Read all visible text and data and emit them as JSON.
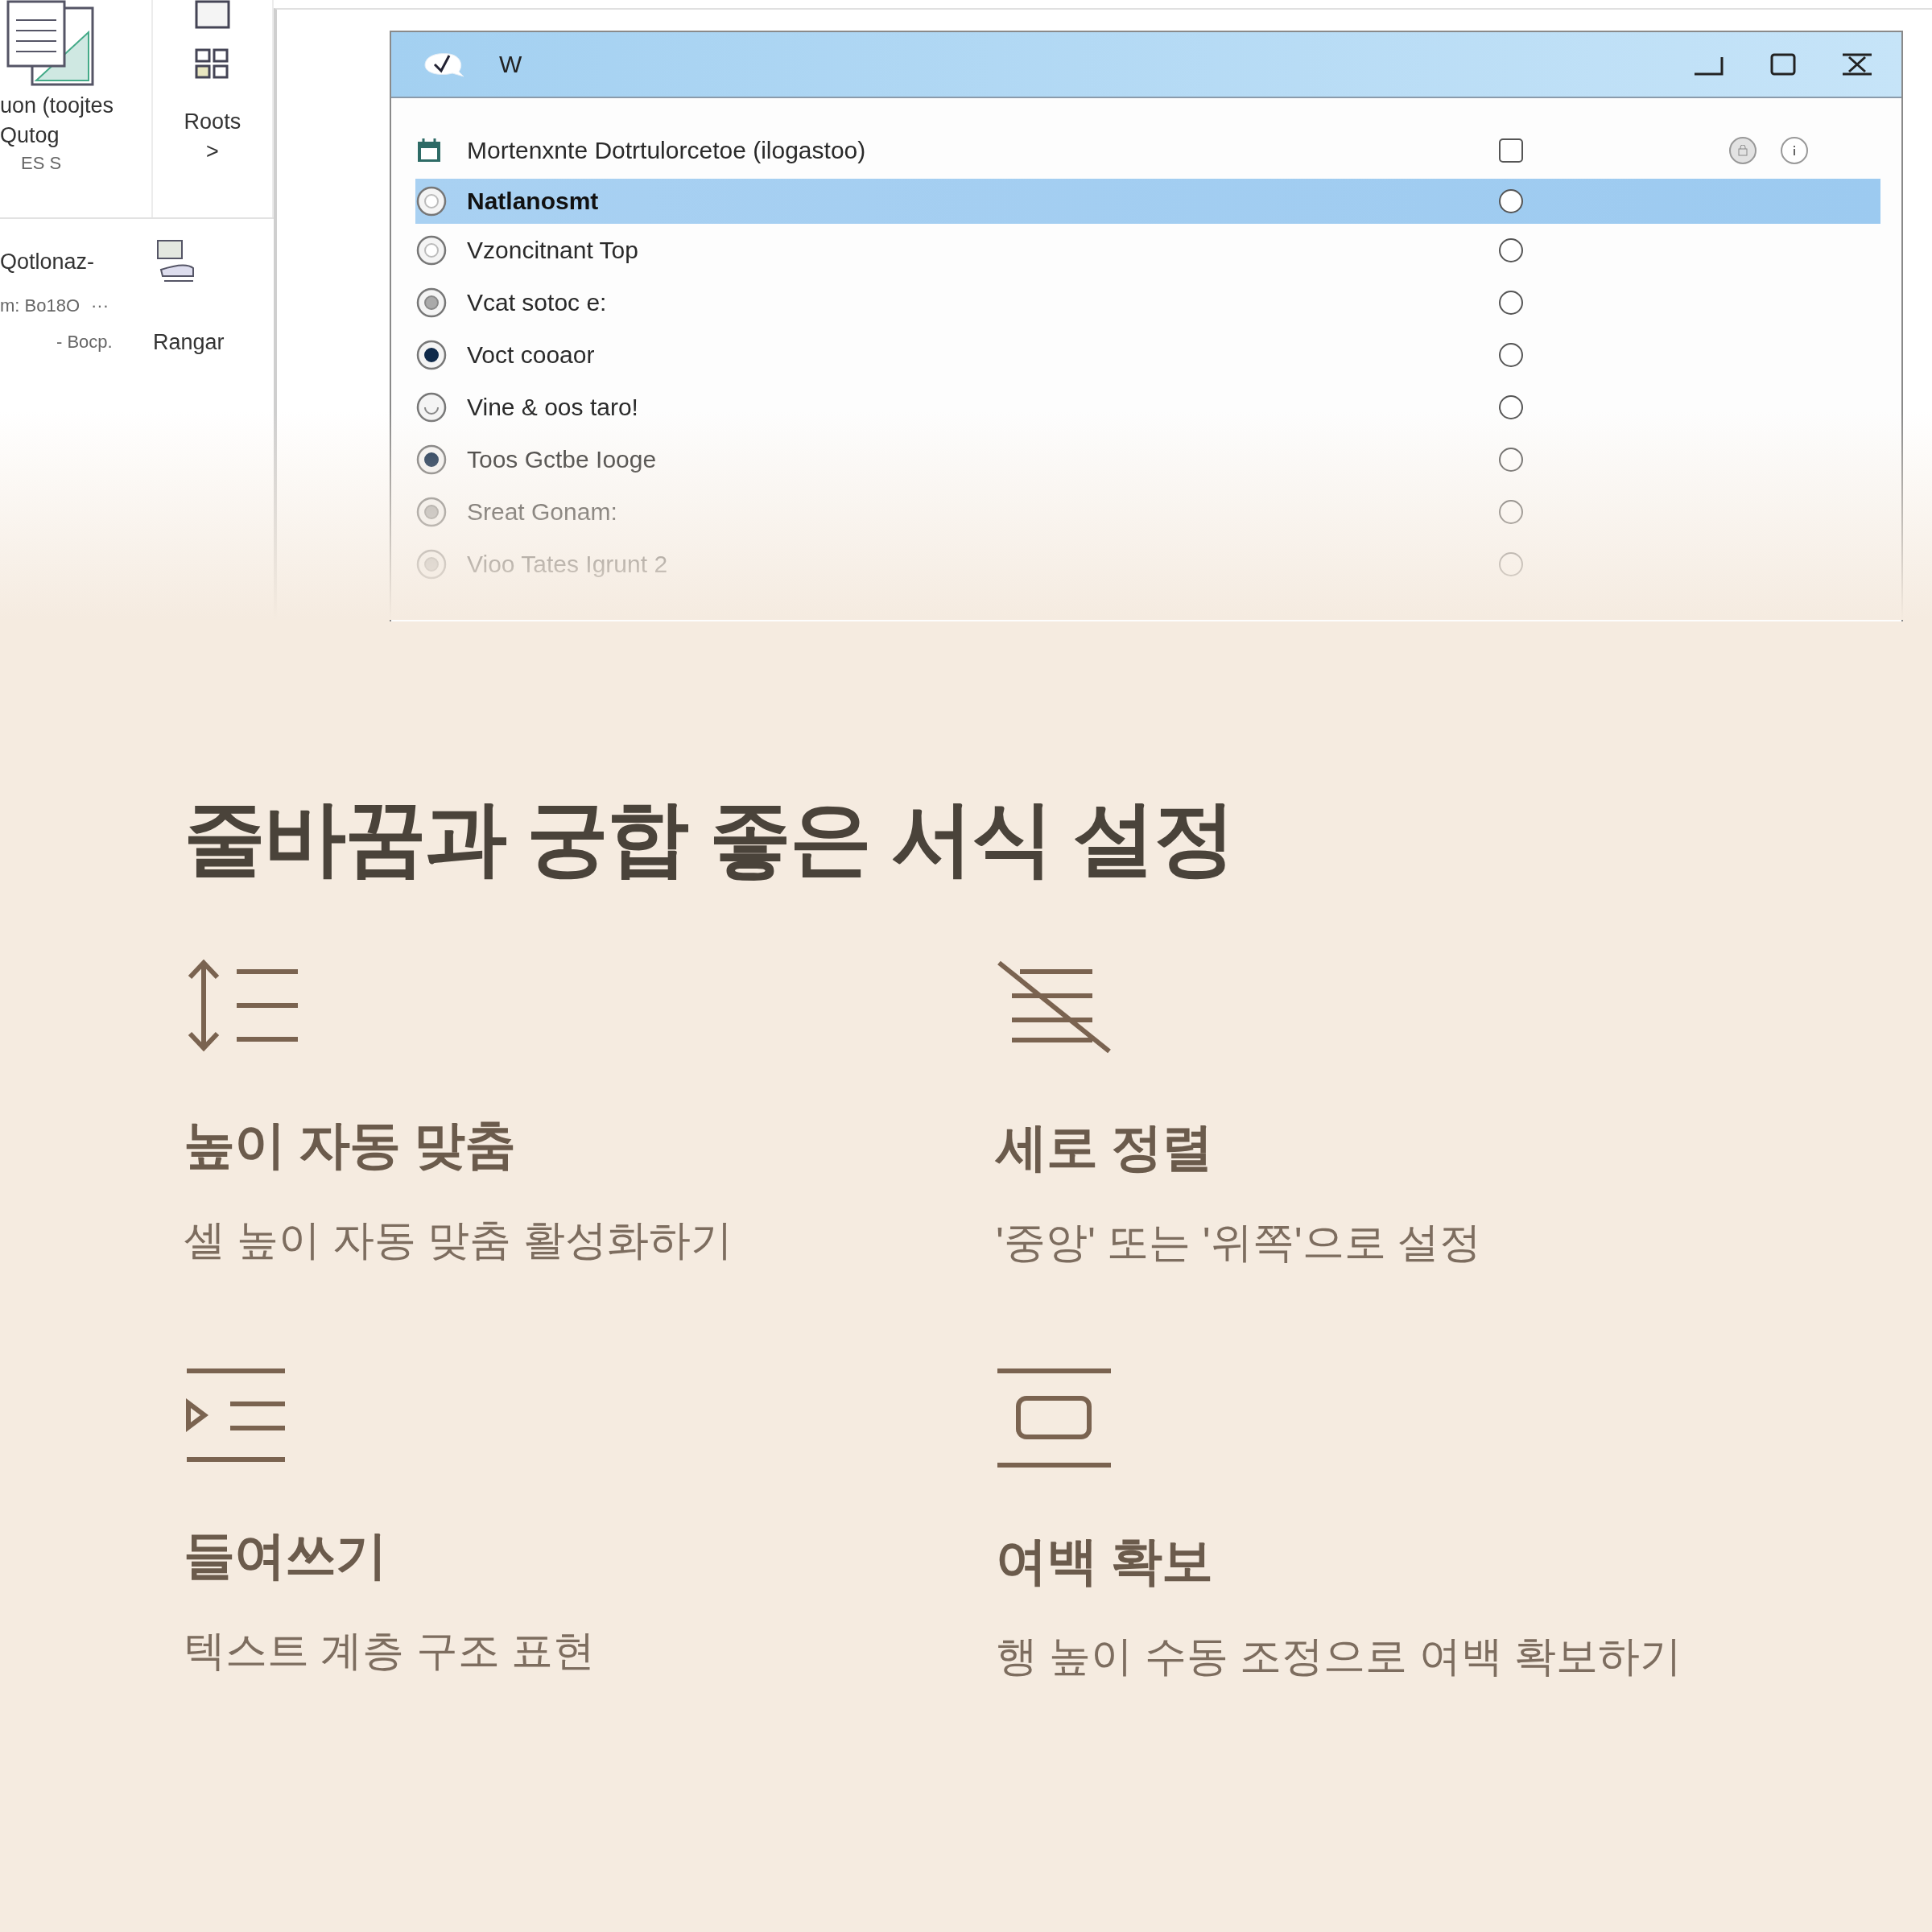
{
  "ribbon": {
    "top_groups": [
      {
        "kind": "document",
        "labels": [
          "uon (toojtes",
          "Qutog",
          "ES S"
        ]
      },
      {
        "kind": "grid",
        "labels": [
          "Roots",
          ">"
        ]
      }
    ],
    "lower": {
      "labels": [
        "Qotlonaz-",
        "m: Bo18O",
        "···",
        "- Bocp.",
        "Rangar"
      ]
    }
  },
  "dialog": {
    "title": "W",
    "header": {
      "label": "Mortenxnte Dotrtulorcetoe (ilogastoo)",
      "checked": false
    },
    "options": [
      {
        "label": "Natlanosmt",
        "kind": "ring",
        "selected": true,
        "checked": false
      },
      {
        "label": "Vzoncitnant Top",
        "kind": "ring",
        "selected": false,
        "checked": false
      },
      {
        "label": "Vcat sotoc e:",
        "kind": "grey",
        "selected": false,
        "checked": false
      },
      {
        "label": "Voct cooaor",
        "kind": "filled",
        "selected": false,
        "checked": false
      },
      {
        "label": "Vine & oos taro!",
        "kind": "empty",
        "selected": false,
        "checked": false
      },
      {
        "label": "Toos Gctbe Iooge",
        "kind": "filled",
        "selected": false,
        "checked": false
      },
      {
        "label": "Sreat Gonam:",
        "kind": "grey",
        "selected": false,
        "checked": false
      },
      {
        "label": "Vioo Tates Igrunt 2",
        "kind": "grey",
        "selected": false,
        "checked": false
      }
    ]
  },
  "heading": "줄바꿈과 궁합 좋은 서식 설정",
  "features": [
    {
      "kind": "line-height",
      "title": "높이 자동 맞춤",
      "description": "셀 높이 자동 맞춤 활성화하기"
    },
    {
      "kind": "vertical-align",
      "title": "세로 정렬",
      "description": "'중앙' 또는 '위쪽'으로 설정"
    },
    {
      "kind": "indent",
      "title": "들여쓰기",
      "description": "텍스트 계층 구조 표현"
    },
    {
      "kind": "margin",
      "title": "여백 확보",
      "description": "행 높이 수동 조정으로 여백 확보하기"
    }
  ]
}
